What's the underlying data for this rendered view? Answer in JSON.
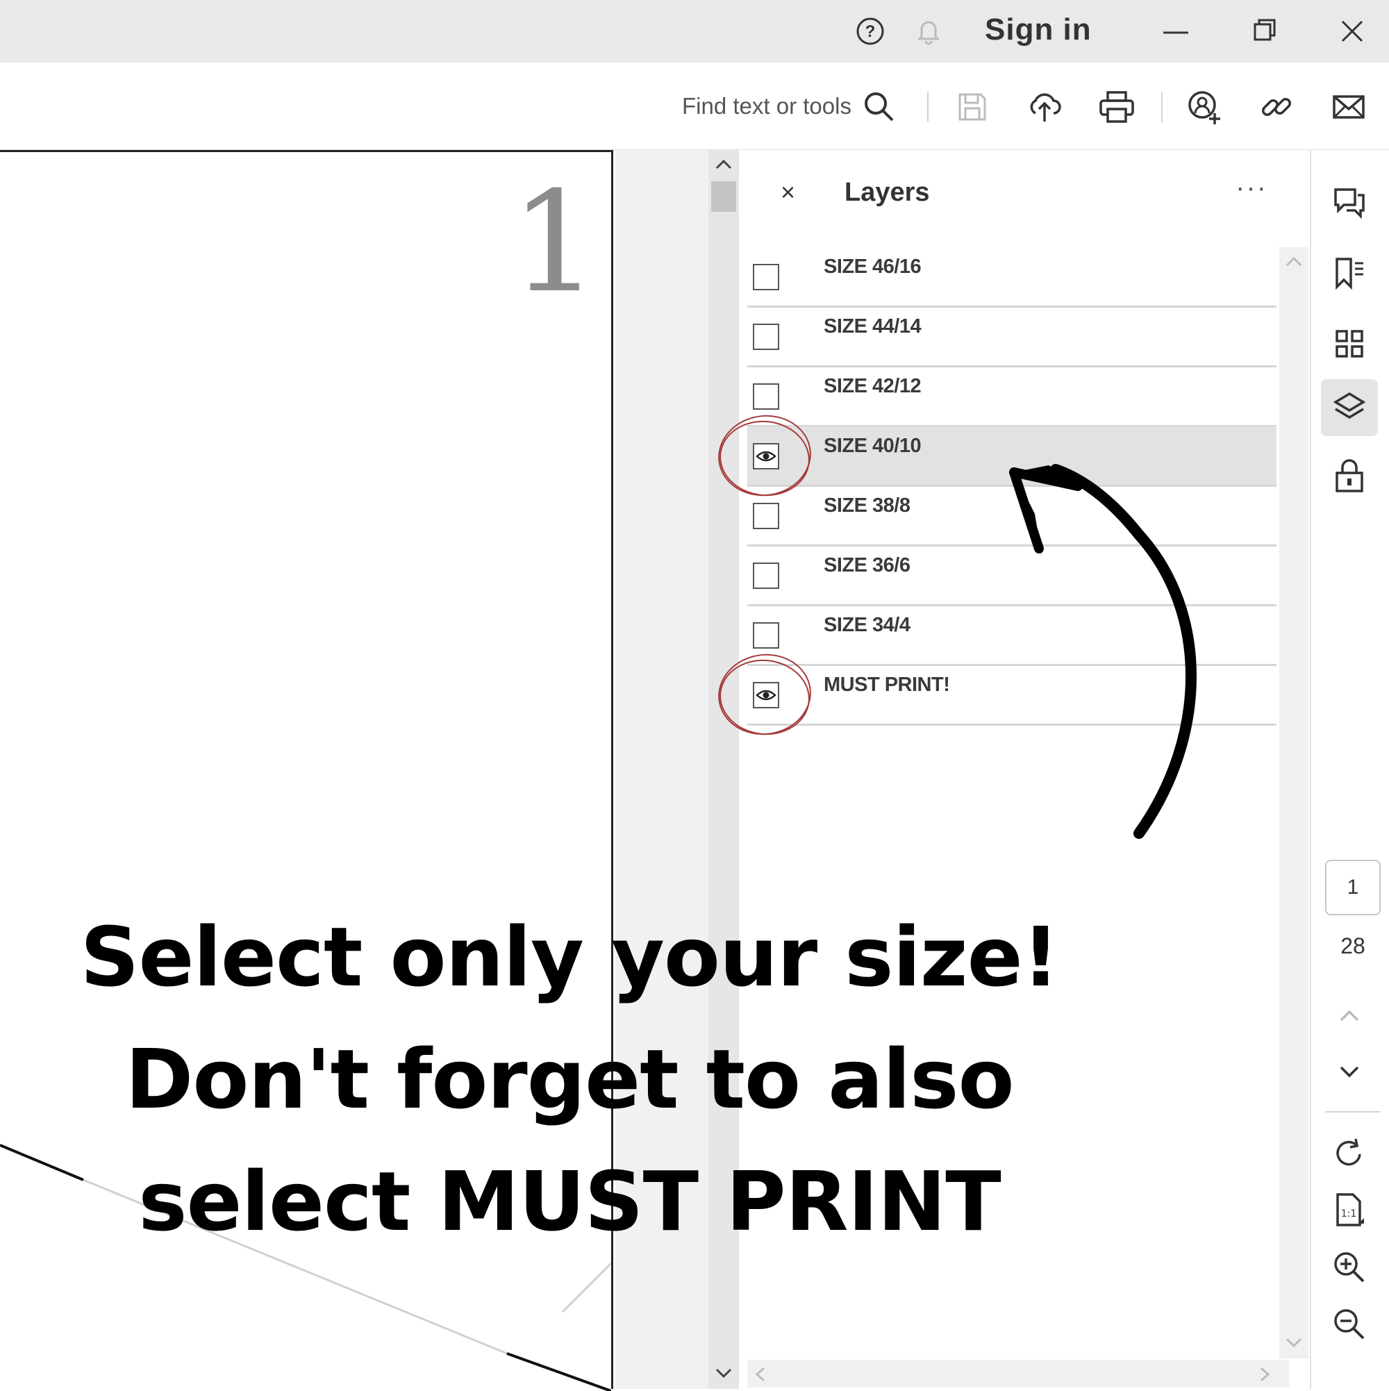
{
  "titlebar": {
    "signin_label": "Sign in"
  },
  "toolbar": {
    "find_label": "Find text or tools"
  },
  "document": {
    "page_number_display": "1"
  },
  "layers_panel": {
    "title": "Layers",
    "close_glyph": "×",
    "more_glyph": "···",
    "layers": [
      {
        "label": "SIZE 46/16",
        "visible": false,
        "selected": false
      },
      {
        "label": "SIZE 44/14",
        "visible": false,
        "selected": false
      },
      {
        "label": "SIZE 42/12",
        "visible": false,
        "selected": false
      },
      {
        "label": "SIZE 40/10",
        "visible": true,
        "selected": true
      },
      {
        "label": "SIZE 38/8",
        "visible": false,
        "selected": false
      },
      {
        "label": "SIZE 36/6",
        "visible": false,
        "selected": false
      },
      {
        "label": "SIZE 34/4",
        "visible": false,
        "selected": false
      },
      {
        "label": "MUST PRINT!",
        "visible": true,
        "selected": false
      }
    ]
  },
  "page_nav": {
    "current_page": "1",
    "total_pages": "28"
  },
  "overlay": {
    "line1": "Select only your size!",
    "line2": "Don't forget to also",
    "line3": "select MUST PRINT"
  },
  "colors": {
    "annotation_ring": "#a53a3a",
    "titlebar_bg": "#e9e9e9",
    "selected_row_bg": "#e2e2e2"
  }
}
